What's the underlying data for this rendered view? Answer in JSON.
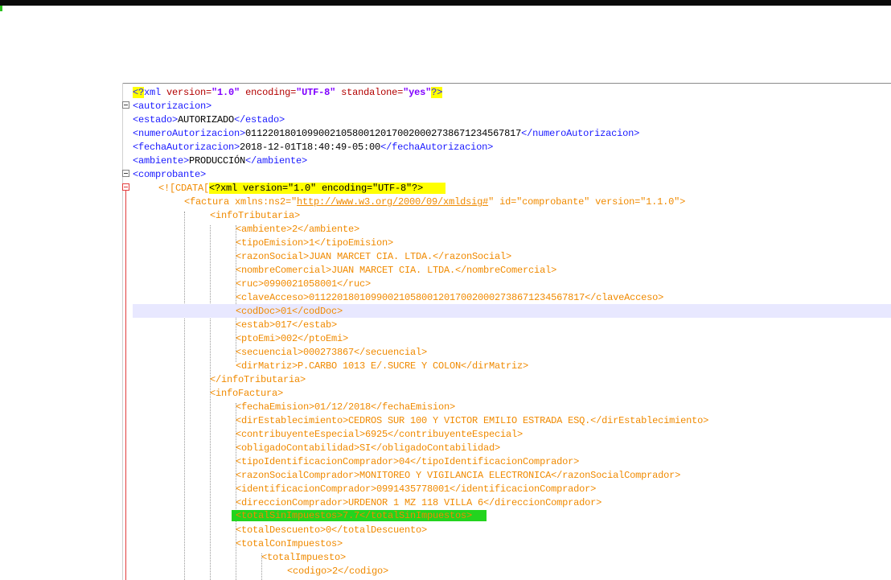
{
  "colors": {
    "tag": "#1a1aff",
    "cdata_text": "#f08a00",
    "yellow_highlight": "#ffff00",
    "green_highlight": "#23d41e",
    "current_line": "#e8e8ff"
  },
  "xml_declaration": {
    "open": "<?",
    "name": "xml ",
    "version_attr": "version=",
    "version_val": "\"1.0\"",
    "encoding_attr": " encoding=",
    "encoding_val": "\"UTF-8\"",
    "standalone_attr": " standalone=",
    "standalone_val": "\"yes\"",
    "close": "?>"
  },
  "autorizacion": {
    "open_tag": "<autorizacion>",
    "estado": {
      "open": "<estado>",
      "value": "AUTORIZADO",
      "close": "</estado>"
    },
    "numero": {
      "open": "<numeroAutorizacion>",
      "value": "0112201801099002105800120170020002738671234567817",
      "close": "</numeroAutorizacion>"
    },
    "fecha": {
      "open": "<fechaAutorizacion>",
      "value": "2018-12-01T18:40:49-05:00",
      "close": "</fechaAutorizacion>"
    },
    "ambiente": {
      "open": "<ambiente>",
      "value": "PRODUCCIÓN",
      "close": "</ambiente>"
    },
    "comprobante_open": "<comprobante>"
  },
  "cdata_line": {
    "prefix": "<![CDATA[",
    "inner_decl": "<?xml version=\"1.0\" encoding=\"UTF-8\"?>"
  },
  "factura_line": {
    "prefix": "<factura xmlns:ns2=\"",
    "url": "http://www.w3.org/2000/09/xmldsig#",
    "suffix": "\" id=\"comprobante\" version=\"1.1.0\">"
  },
  "cdata_lines": [
    "<infoTributaria>",
    "<ambiente>2</ambiente>",
    "<tipoEmision>1</tipoEmision>",
    "<razonSocial>JUAN MARCET CIA. LTDA.</razonSocial>",
    "<nombreComercial>JUAN MARCET CIA. LTDA.</nombreComercial>",
    "<ruc>0990021058001</ruc>",
    "<claveAcceso>0112201801099002105800120170020002738671234567817</claveAcceso>",
    "<codDoc>01</codDoc>",
    "<estab>017</estab>",
    "<ptoEmi>002</ptoEmi>",
    "<secuencial>000273867</secuencial>",
    "<dirMatriz>P.CARBO 1013 E/.SUCRE Y COLON</dirMatriz>",
    "</infoTributaria>",
    "<infoFactura>",
    "<fechaEmision>01/12/2018</fechaEmision>",
    "<dirEstablecimiento>CEDROS SUR 100 Y VICTOR EMILIO ESTRADA ESQ.</dirEstablecimiento>",
    "<contribuyenteEspecial>6925</contribuyenteEspecial>",
    "<obligadoContabilidad>SI</obligadoContabilidad>",
    "<tipoIdentificacionComprador>04</tipoIdentificacionComprador>",
    "<razonSocialComprador>MONITOREO Y VIGILANCIA ELECTRONICA</razonSocialComprador>",
    "<identificacionComprador>0991435778001</identificacionComprador>",
    "<direccionComprador>URDENOR 1 MZ 118 VILLA 6</direccionComprador>",
    "<totalSinImpuestos>7.7</totalSinImpuestos>",
    "<totalDescuento>0</totalDescuento>",
    "<totalConImpuestos>",
    "<totalImpuesto>",
    "<codigo>2</codigo>"
  ]
}
